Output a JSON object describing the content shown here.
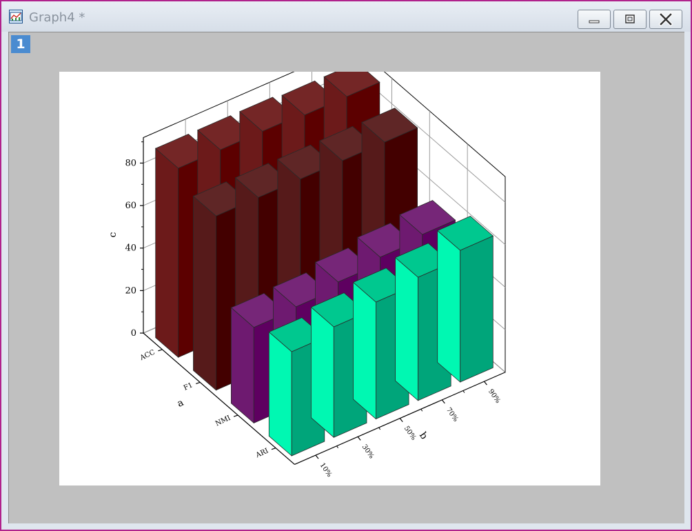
{
  "window": {
    "title": "Graph4 *",
    "page_number": "1"
  },
  "icons": {
    "app": "graph-window-icon",
    "minimize": "minimize-icon",
    "maximize": "maximize-icon",
    "close": "close-icon"
  },
  "colors": {
    "window_border": "#b0228c",
    "page_badge": "#4a8bd0",
    "client_background": "#c0c0c0"
  },
  "chart_data": {
    "type": "bar3d",
    "title": "",
    "xlabel": "b",
    "ylabel": "a",
    "zlabel": "c",
    "x_categories": [
      "10%",
      "30%",
      "50%",
      "70%",
      "90%"
    ],
    "y_categories": [
      "ACC",
      "F1",
      "NMI",
      "ARI"
    ],
    "zlim": [
      0,
      92
    ],
    "z_ticks": [
      "0",
      "20",
      "40",
      "60",
      "80"
    ],
    "grid": true,
    "series": [
      {
        "name": "ACC",
        "values": [
          89,
          89,
          89,
          88,
          88
        ],
        "color": "#5c0000"
      },
      {
        "name": "F1",
        "values": [
          82,
          82,
          82,
          82,
          82
        ],
        "color": "#430000"
      },
      {
        "name": "NMI",
        "values": [
          45,
          46,
          49,
          52,
          54
        ],
        "color": "#5e0060"
      },
      {
        "name": "ARI",
        "values": [
          49,
          52,
          55,
          58,
          62
        ],
        "color": "#00a57a"
      }
    ]
  }
}
